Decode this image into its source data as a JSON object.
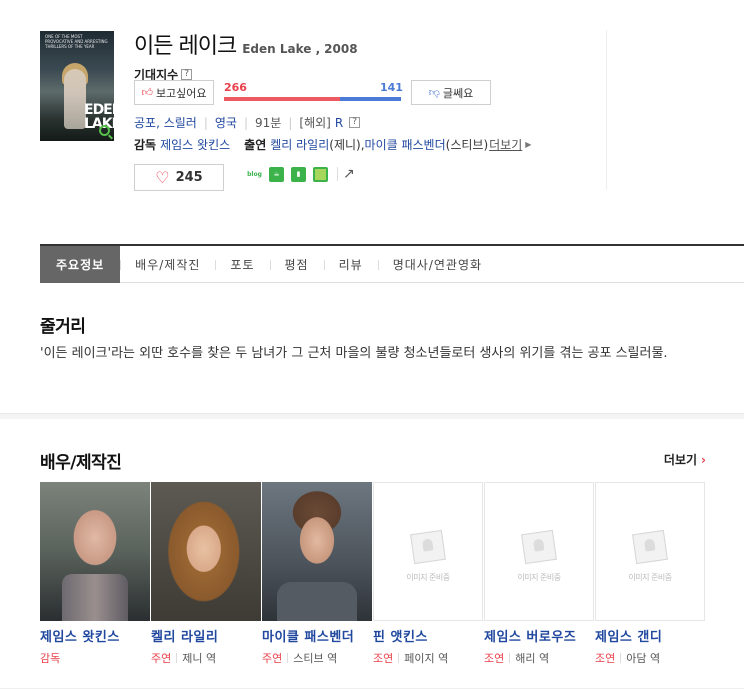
{
  "movie": {
    "title_ko": "이든 레이크",
    "title_en": "Eden Lake ,",
    "year": "2008",
    "poster_tag": "ONE OF THE MOST PROVOCATIVE AND ARRESTING THRILLERS OF THE YEAR",
    "poster_title": "EDEN LAKE"
  },
  "expect": {
    "label": "기대지수",
    "help": "?",
    "want_label": "보고싶어요",
    "nah_label": "글쎄요",
    "want_count": "266",
    "nah_count": "141",
    "want_ratio": 0.654
  },
  "meta": {
    "genre": "공포, 스릴러",
    "country": "영국",
    "runtime": "91분",
    "rating_prefix": "[해외]",
    "rating": "R",
    "help": "?"
  },
  "credits": {
    "director_label": "감독",
    "director": "제임스 왓킨스",
    "cast_label": "출연",
    "actor1": "켈리 라일리",
    "actor1_role": "(제니),",
    "actor2": "마이클 패스벤더",
    "actor2_role": "(스티브)",
    "more": "더보기"
  },
  "like": {
    "count": "245"
  },
  "share": {
    "blog": "blog"
  },
  "tabs": [
    {
      "label": "주요정보"
    },
    {
      "label": "배우/제작진"
    },
    {
      "label": "포토"
    },
    {
      "label": "평점"
    },
    {
      "label": "리뷰"
    },
    {
      "label": "명대사/연관영화"
    }
  ],
  "synopsis": {
    "title": "줄거리",
    "text": "'이든 레이크'라는 외딴 호수를 찾은 두 남녀가 그 근처 마을의 불량 청소년들로터 생사의 위기를 겪는 공포 스릴러물."
  },
  "cast_section": {
    "title": "배우/제작진",
    "more": "더보기",
    "placeholder": "이미지 준비중",
    "members": [
      {
        "name": "제임스 왓킨스",
        "role": "감독",
        "character": ""
      },
      {
        "name": "켈리 라일리",
        "role": "주연",
        "character": "제니 역"
      },
      {
        "name": "마이클 패스벤더",
        "role": "주연",
        "character": "스티브 역"
      },
      {
        "name": "핀 앳킨스",
        "role": "조연",
        "character": "페이지 역"
      },
      {
        "name": "제임스 버로우즈",
        "role": "조연",
        "character": "해리 역"
      },
      {
        "name": "제임스 갠디",
        "role": "조연",
        "character": "아담 역"
      }
    ]
  }
}
